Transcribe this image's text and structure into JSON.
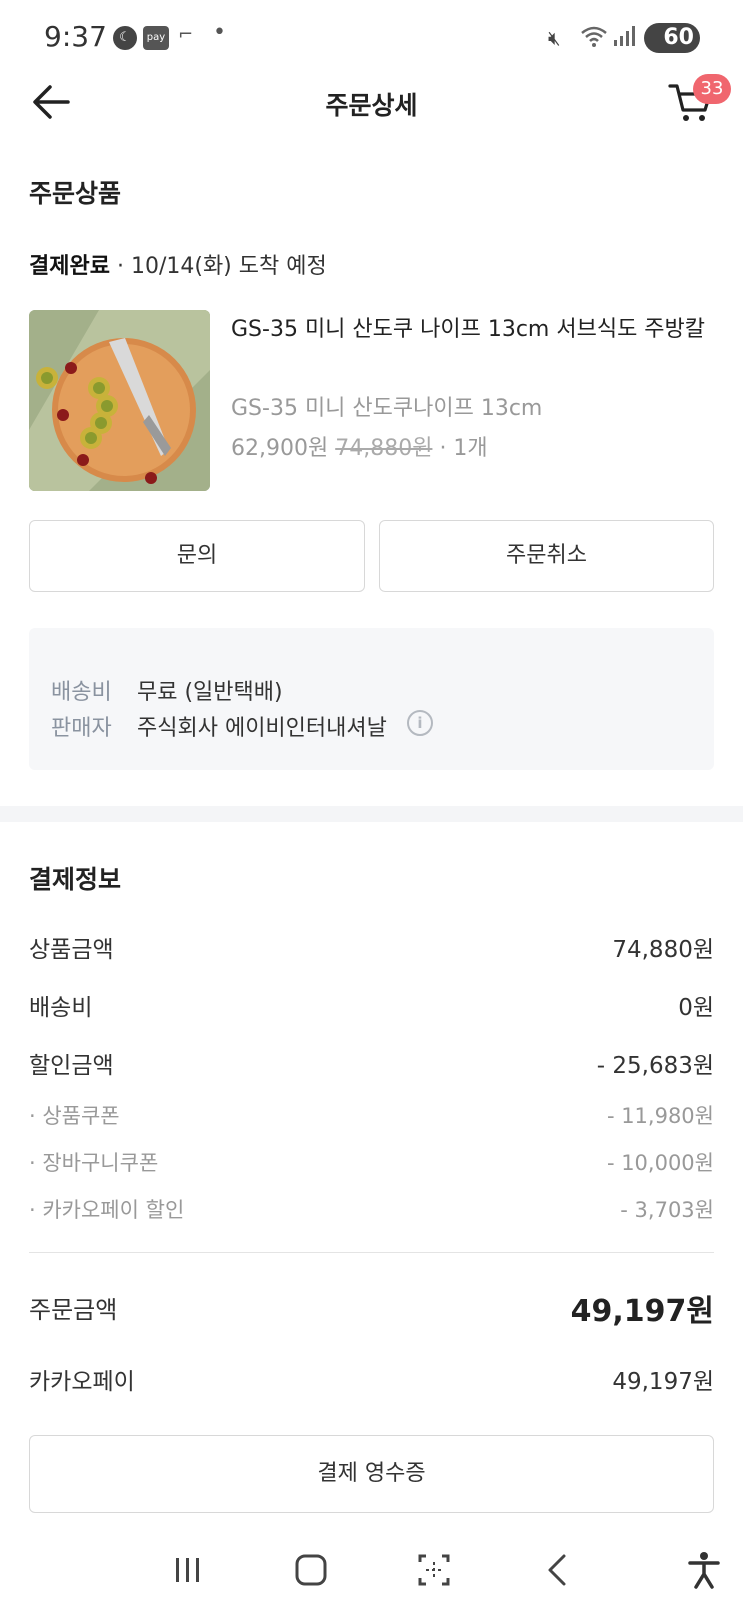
{
  "status_bar": {
    "time": "9:37",
    "pay_label": "pay",
    "battery": "60"
  },
  "header": {
    "title": "주문상세",
    "cart_count": "33"
  },
  "order_items": {
    "section_title": "주문상품",
    "status_label": "결제완료",
    "delivery_text": "· 10/14(화) 도착 예정",
    "product": {
      "name": "GS-35 미니 산도쿠 나이프 13cm 서브식도 주방칼",
      "option": "GS-35 미니 산도쿠나이프 13cm",
      "price": "62,900원",
      "original_price": "74,880원",
      "quantity": "· 1개"
    },
    "inquiry_button": "문의",
    "cancel_button": "주문취소"
  },
  "shipping_info": {
    "fee_label": "배송비",
    "fee_value": "무료 (일반택배)",
    "seller_label": "판매자",
    "seller_value": "주식회사 에이비인터내셔날"
  },
  "payment_info": {
    "section_title": "결제정보",
    "product_amount_label": "상품금액",
    "product_amount": "74,880원",
    "shipping_label": "배송비",
    "shipping_amount": "0원",
    "discount_label": "할인금액",
    "discount_amount": "- 25,683원",
    "discounts": [
      {
        "label": "· 상품쿠폰",
        "amount": "- 11,980원"
      },
      {
        "label": "· 장바구니쿠폰",
        "amount": "- 10,000원"
      },
      {
        "label": "· 카카오페이 할인",
        "amount": "- 3,703원"
      }
    ],
    "order_total_label": "주문금액",
    "order_total": "49,197원",
    "method_label": "카카오페이",
    "method_amount": "49,197원",
    "receipt_button": "결제 영수증"
  },
  "colors": {
    "badge": "#f0666e",
    "info_box": "#f6f7f9",
    "muted_text": "#999999"
  }
}
